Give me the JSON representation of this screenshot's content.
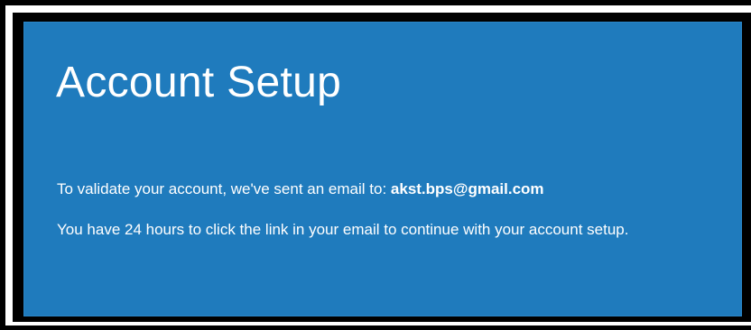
{
  "colors": {
    "page_background": "#000000",
    "frame_border": "#ffffff",
    "panel_background": "#1f7bbd",
    "text": "#ffffff"
  },
  "card": {
    "title": "Account Setup",
    "validation_text": "To validate your account, we've sent an email to:",
    "email": "akst.bps@gmail.com",
    "instruction_text": "You have 24 hours to click the link in your email to continue with your account setup."
  }
}
